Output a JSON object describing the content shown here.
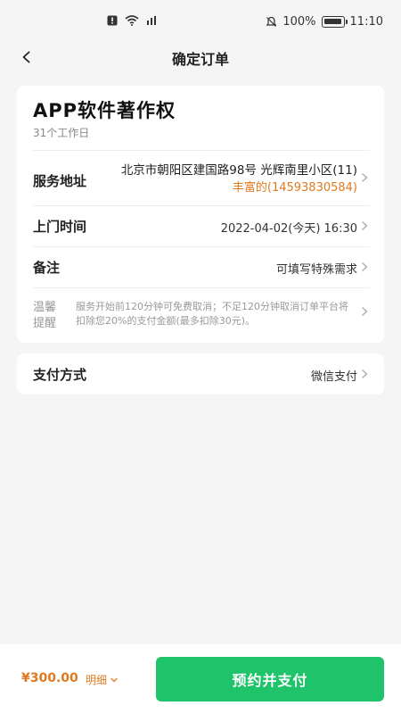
{
  "status": {
    "battery": "100%",
    "time": "11:10",
    "icons": [
      "notification-icon",
      "wifi-icon",
      "signal-icon",
      "mute-icon",
      "battery-icon"
    ]
  },
  "nav": {
    "title": "确定订单",
    "back_icon": "chevron-left-icon"
  },
  "product": {
    "title": "APP软件著作权",
    "subtitle": "31个工作日"
  },
  "address": {
    "label": "服务地址",
    "line1": "北京市朝阳区建国路98号 光辉南里小区(11)",
    "line2": "丰富的(14593830584)"
  },
  "visit_time": {
    "label": "上门时间",
    "value": "2022-04-02(今天) 16:30"
  },
  "remark": {
    "label": "备注",
    "placeholder": "可填写特殊需求"
  },
  "tips": {
    "label": "温馨提醒",
    "text": "服务开始前120分钟可免费取消；不足120分钟取消订单平台将扣除您20%的支付金额(最多扣除30元)。"
  },
  "payment": {
    "label": "支付方式",
    "value": "微信支付"
  },
  "footer": {
    "price": "¥300.00",
    "detail_label": "明细",
    "submit_label": "预约并支付"
  },
  "colors": {
    "accent": "#1fc36a",
    "price": "#e07a1f",
    "background": "#f5f5f5"
  }
}
